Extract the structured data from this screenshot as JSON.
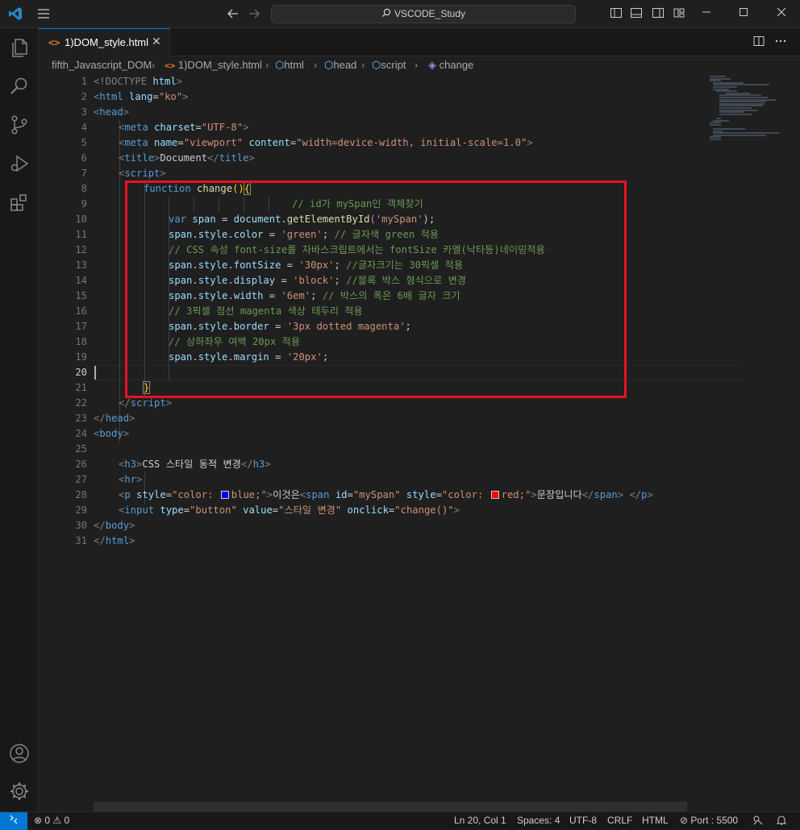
{
  "titlebar": {
    "search_text": "VSCODE_Study",
    "search_icon": "search-icon"
  },
  "tab": {
    "file_icon_text": "<>",
    "label": "1)DOM_style.html",
    "close": "✕"
  },
  "breadcrumb": {
    "items": [
      "fifth_Javascript_DOM",
      "1)DOM_style.html",
      "html",
      "head",
      "script",
      "change"
    ]
  },
  "editor": {
    "line_numbers": [
      "1",
      "2",
      "3",
      "4",
      "5",
      "6",
      "7",
      "8",
      "9",
      "10",
      "11",
      "12",
      "13",
      "14",
      "15",
      "16",
      "17",
      "18",
      "19",
      "20",
      "21",
      "22",
      "23",
      "24",
      "25",
      "26",
      "27",
      "28",
      "29",
      "30",
      "31"
    ],
    "active_line": "20",
    "lines": {
      "l1": {
        "a": "<!DOCTYPE",
        "b": " html",
        "c": ">"
      },
      "l2": {
        "a": "<",
        "b": "html",
        "c": " lang",
        "d": "=",
        "e": "\"ko\"",
        "f": ">"
      },
      "l3": {
        "a": "<",
        "b": "head",
        "c": ">"
      },
      "l4": {
        "a": "<",
        "b": "meta",
        "c": " charset",
        "d": "=",
        "e": "\"UTF-8\"",
        "f": ">"
      },
      "l5": {
        "a": "<",
        "b": "meta",
        "c": " name",
        "d": "=",
        "e": "\"viewport\"",
        "f": " content",
        "g": "=",
        "h": "\"width=device-width, initial-scale=1.0\"",
        "i": ">"
      },
      "l6": {
        "a": "<",
        "b": "title",
        "c": ">",
        "d": "Document",
        "e": "</",
        "f": "title",
        "g": ">"
      },
      "l7": {
        "a": "<",
        "b": "script",
        "c": ">"
      },
      "l8": {
        "a": "function",
        "b": " change",
        "c": "()",
        "d": "{"
      },
      "l9": {
        "a": "// id가 mySpan인 객체찾기"
      },
      "l10": {
        "a": "var",
        "b": " span",
        "c": " = ",
        "d": "document",
        "e": ".",
        "f": "getElementById",
        "g": "(",
        "h": "'mySpan'",
        "i": ");"
      },
      "l11": {
        "a": "span",
        "b": ".",
        "c": "style",
        "d": ".",
        "e": "color",
        "f": " = ",
        "g": "'green'",
        "h": "; ",
        "i": "// 글자색 green 적용"
      },
      "l12": {
        "a": "// CSS 속성 font-size를 자바스크립트에서는 fontSize 카멜(낙타등)네이밍적용"
      },
      "l13": {
        "a": "span",
        "b": ".",
        "c": "style",
        "d": ".",
        "e": "fontSize",
        "f": " = ",
        "g": "'30px'",
        "h": "; ",
        "i": "//글자크기는 30픽셀 적용"
      },
      "l14": {
        "a": "span",
        "b": ".",
        "c": "style",
        "d": ".",
        "e": "display",
        "f": " = ",
        "g": "'block'",
        "h": "; ",
        "i": "//블록 박스 형식으로 변경"
      },
      "l15": {
        "a": "span",
        "b": ".",
        "c": "style",
        "d": ".",
        "e": "width",
        "f": " = ",
        "g": "'6em'",
        "h": "; ",
        "i": "// 박스의 폭은 6배 글자 크기"
      },
      "l16": {
        "a": "// 3픽셀 점선 magenta 색상 테두리 적용"
      },
      "l17": {
        "a": "span",
        "b": ".",
        "c": "style",
        "d": ".",
        "e": "border",
        "f": " = ",
        "g": "'3px dotted magenta'",
        "h": ";"
      },
      "l18": {
        "a": "// 상하좌우 여백 20px 적용"
      },
      "l19": {
        "a": "span",
        "b": ".",
        "c": "style",
        "d": ".",
        "e": "margin",
        "f": " = ",
        "g": "'20px'",
        "h": ";"
      },
      "l21": {
        "a": "}"
      },
      "l22": {
        "a": "</",
        "b": "script",
        "c": ">"
      },
      "l23": {
        "a": "</",
        "b": "head",
        "c": ">"
      },
      "l24": {
        "a": "<",
        "b": "body",
        "c": ">"
      },
      "l26": {
        "a": "<",
        "b": "h3",
        "c": ">",
        "d": "CSS 스타일 동적 변경",
        "e": "</",
        "f": "h3",
        "g": ">"
      },
      "l27": {
        "a": "<",
        "b": "hr",
        "c": ">"
      },
      "l28": {
        "a": "<",
        "b": "p",
        "c": " style",
        "d": "=",
        "e": "\"color: ",
        "f": "blue;\"",
        "g": ">",
        "h": "이것은",
        "i": "<",
        "j": "span",
        "k": " id",
        "l": "=",
        "m": "\"mySpan\"",
        "n": " style",
        "o": "=",
        "p": "\"color: ",
        "q": "red;\"",
        "r": ">",
        "s": "문장입니다",
        "t": "</",
        "u": "span",
        "v": ">",
        "w": " </",
        "x": "p",
        "y": ">"
      },
      "l29": {
        "a": "<",
        "b": "input",
        "c": " type",
        "d": "=",
        "e": "\"button\"",
        "f": " value",
        "g": "=",
        "h": "\"스타일 변경\"",
        "i": " onclick",
        "j": "=",
        "k": "\"change()\"",
        "l": ">"
      },
      "l30": {
        "a": "</",
        "b": "body",
        "c": ">"
      },
      "l31": {
        "a": "</",
        "b": "html",
        "c": ">"
      }
    },
    "swatch_colors": {
      "blue": "#0000ff",
      "red": "#ff0000"
    }
  },
  "statusbar": {
    "remote_icon": "remote-icon",
    "problems": "⊗ 0 ⚠ 0",
    "cursor": "Ln 20, Col 1",
    "spaces": "Spaces: 4",
    "encoding": "UTF-8",
    "eol": "CRLF",
    "language": "HTML",
    "port": "⊘ Port : 5500"
  },
  "colors": {
    "accent": "#0078d4",
    "highlight_box": "#e81123"
  }
}
